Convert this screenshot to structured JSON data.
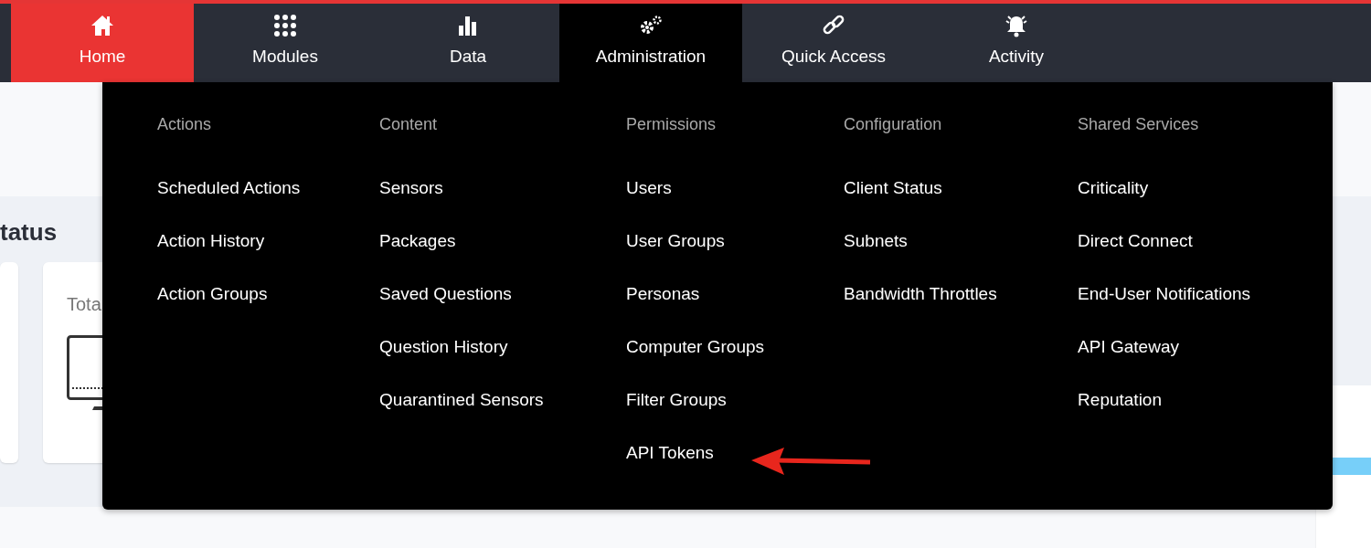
{
  "nav": {
    "tabs": [
      {
        "label": "Home",
        "current": true,
        "selected": false
      },
      {
        "label": "Modules",
        "current": false,
        "selected": false
      },
      {
        "label": "Data",
        "current": false,
        "selected": false
      },
      {
        "label": "Administration",
        "current": false,
        "selected": true
      },
      {
        "label": "Quick Access",
        "current": false,
        "selected": false
      },
      {
        "label": "Activity",
        "current": false,
        "selected": false
      }
    ]
  },
  "background": {
    "heading": "tatus",
    "card_label": "Tota"
  },
  "menu": {
    "columns": [
      {
        "heading": "Actions",
        "items": [
          "Scheduled Actions",
          "Action History",
          "Action Groups"
        ]
      },
      {
        "heading": "Content",
        "items": [
          "Sensors",
          "Packages",
          "Saved Questions",
          "Question History",
          "Quarantined Sensors"
        ]
      },
      {
        "heading": "Permissions",
        "items": [
          "Users",
          "User Groups",
          "Personas",
          "Computer Groups",
          "Filter Groups",
          "API Tokens"
        ]
      },
      {
        "heading": "Configuration",
        "items": [
          "Client Status",
          "Subnets",
          "Bandwidth Throttles"
        ]
      },
      {
        "heading": "Shared Services",
        "items": [
          "Criticality",
          "Direct Connect",
          "End-User Notifications",
          "API Gateway",
          "Reputation"
        ]
      }
    ]
  }
}
